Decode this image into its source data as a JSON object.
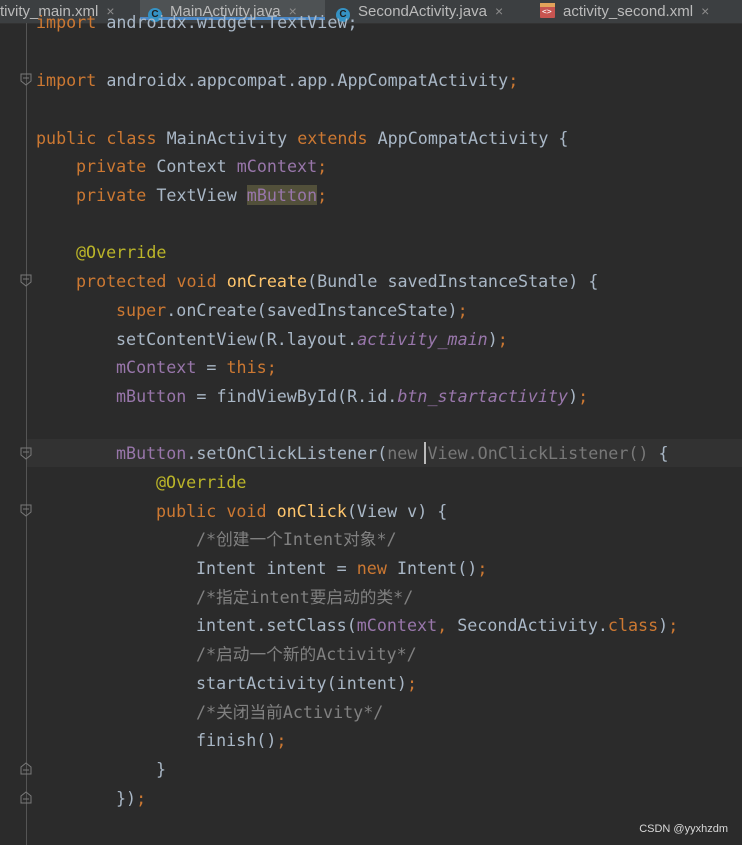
{
  "tabs": [
    {
      "label": "tivity_main.xml",
      "icon": "xml-file-icon",
      "active": false
    },
    {
      "label": "MainActivity.java",
      "icon": "java-class-icon",
      "active": true
    },
    {
      "label": "SecondActivity.java",
      "icon": "java-class-icon",
      "active": false
    },
    {
      "label": "activity_second.xml",
      "icon": "layout-xml-icon",
      "active": false
    }
  ],
  "tab_close_glyph": "×",
  "colors": {
    "background": "#2b2b2b",
    "keyword": "#cc7832",
    "field": "#9876aa",
    "annotation": "#bbb529",
    "method_decl": "#ffc66d",
    "comment": "#808080",
    "plain": "#a9b7c6",
    "tab_active_underline": "#4a88c7"
  },
  "code": {
    "l00": {
      "a": "import ",
      "b": "androidx.widget.TextView;"
    },
    "l02": {
      "a": "import ",
      "b": "androidx.appcompat.app.AppCompatActivity",
      "c": ";"
    },
    "l04": {
      "a": "public class ",
      "b": "MainActivity ",
      "c": "extends ",
      "d": "AppCompatActivity {"
    },
    "l05": {
      "a": "private ",
      "b": "Context ",
      "c": "mContext",
      "d": ";"
    },
    "l06": {
      "a": "private ",
      "b": "TextView ",
      "c": "mButton",
      "d": ";"
    },
    "l08": {
      "a": "@Override"
    },
    "l09": {
      "a": "protected void ",
      "b": "onCreate",
      "c": "(Bundle savedInstanceState) {"
    },
    "l10": {
      "a": "super",
      "b": ".onCreate(savedInstanceState)",
      "c": ";"
    },
    "l11": {
      "a": "setContentView(R.layout.",
      "b": "activity_main",
      "c": ")",
      "d": ";"
    },
    "l12": {
      "a": "mContext",
      "b": " = ",
      "c": "this",
      "d": ";"
    },
    "l13": {
      "a": "mButton",
      "b": " = findViewById(R.id.",
      "c": "btn_startactivity",
      "d": ")",
      "e": ";"
    },
    "l15": {
      "a": "mButton",
      "b": ".setOnClickListener(",
      "c": "new ",
      "d": "View.OnClickListener() ",
      "e": "{"
    },
    "l16": {
      "a": "@Override"
    },
    "l17": {
      "a": "public void ",
      "b": "onClick",
      "c": "(View v) {"
    },
    "l18": {
      "a": "/*创建一个Intent对象*/"
    },
    "l19": {
      "a": "Intent intent = ",
      "b": "new ",
      "c": "Intent()",
      "d": ";"
    },
    "l20": {
      "a": "/*指定intent要启动的类*/"
    },
    "l21": {
      "a": "intent.setClass(",
      "b": "mContext",
      "c": ", ",
      "d": "SecondActivity.",
      "e": "class",
      "f": ")",
      "g": ";"
    },
    "l22": {
      "a": "/*启动一个新的Activity*/"
    },
    "l23": {
      "a": "startActivity(intent)",
      "b": ";"
    },
    "l24": {
      "a": "/*关闭当前Activity*/"
    },
    "l25": {
      "a": "finish()",
      "b": ";"
    },
    "l26": {
      "a": "}"
    },
    "l27": {
      "a": "})",
      "b": ";"
    }
  },
  "watermark": "CSDN @yyxhzdm"
}
